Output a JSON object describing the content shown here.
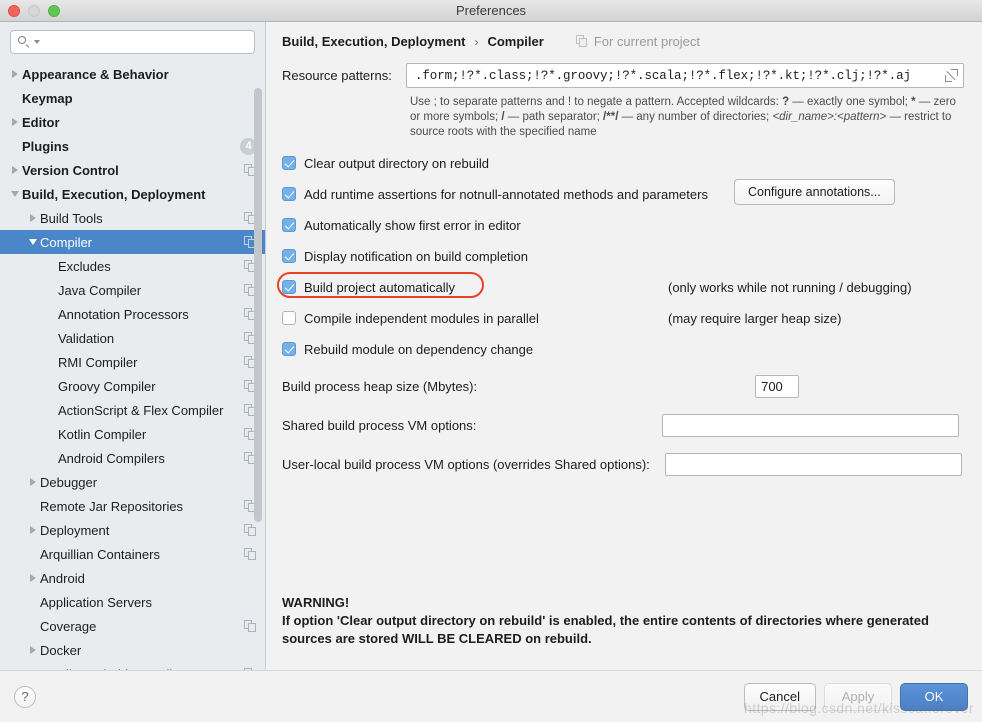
{
  "window": {
    "title": "Preferences",
    "traffic_lights": [
      "close",
      "minimize",
      "zoom"
    ]
  },
  "sidebar": {
    "search": {
      "value": "",
      "placeholder": ""
    },
    "items": [
      {
        "label": "Appearance & Behavior",
        "level": 0,
        "expandable": true,
        "expanded": false,
        "selected": false,
        "copy_icon": false,
        "badge": ""
      },
      {
        "label": "Keymap",
        "level": 0,
        "expandable": false,
        "expanded": false,
        "selected": false,
        "copy_icon": false,
        "badge": ""
      },
      {
        "label": "Editor",
        "level": 0,
        "expandable": true,
        "expanded": false,
        "selected": false,
        "copy_icon": false,
        "badge": ""
      },
      {
        "label": "Plugins",
        "level": 0,
        "expandable": false,
        "expanded": false,
        "selected": false,
        "copy_icon": false,
        "badge": "4"
      },
      {
        "label": "Version Control",
        "level": 0,
        "expandable": true,
        "expanded": false,
        "selected": false,
        "copy_icon": true,
        "badge": ""
      },
      {
        "label": "Build, Execution, Deployment",
        "level": 0,
        "expandable": true,
        "expanded": true,
        "selected": false,
        "copy_icon": false,
        "badge": ""
      },
      {
        "label": "Build Tools",
        "level": 1,
        "expandable": true,
        "expanded": false,
        "selected": false,
        "copy_icon": true,
        "badge": ""
      },
      {
        "label": "Compiler",
        "level": 1,
        "expandable": true,
        "expanded": true,
        "selected": true,
        "copy_icon": true,
        "badge": ""
      },
      {
        "label": "Excludes",
        "level": 2,
        "expandable": false,
        "expanded": false,
        "selected": false,
        "copy_icon": true,
        "badge": ""
      },
      {
        "label": "Java Compiler",
        "level": 2,
        "expandable": false,
        "expanded": false,
        "selected": false,
        "copy_icon": true,
        "badge": ""
      },
      {
        "label": "Annotation Processors",
        "level": 2,
        "expandable": false,
        "expanded": false,
        "selected": false,
        "copy_icon": true,
        "badge": ""
      },
      {
        "label": "Validation",
        "level": 2,
        "expandable": false,
        "expanded": false,
        "selected": false,
        "copy_icon": true,
        "badge": ""
      },
      {
        "label": "RMI Compiler",
        "level": 2,
        "expandable": false,
        "expanded": false,
        "selected": false,
        "copy_icon": true,
        "badge": ""
      },
      {
        "label": "Groovy Compiler",
        "level": 2,
        "expandable": false,
        "expanded": false,
        "selected": false,
        "copy_icon": true,
        "badge": ""
      },
      {
        "label": "ActionScript & Flex Compiler",
        "level": 2,
        "expandable": false,
        "expanded": false,
        "selected": false,
        "copy_icon": true,
        "badge": ""
      },
      {
        "label": "Kotlin Compiler",
        "level": 2,
        "expandable": false,
        "expanded": false,
        "selected": false,
        "copy_icon": true,
        "badge": ""
      },
      {
        "label": "Android Compilers",
        "level": 2,
        "expandable": false,
        "expanded": false,
        "selected": false,
        "copy_icon": true,
        "badge": ""
      },
      {
        "label": "Debugger",
        "level": 1,
        "expandable": true,
        "expanded": false,
        "selected": false,
        "copy_icon": false,
        "badge": ""
      },
      {
        "label": "Remote Jar Repositories",
        "level": 1,
        "expandable": false,
        "expanded": false,
        "selected": false,
        "copy_icon": true,
        "badge": ""
      },
      {
        "label": "Deployment",
        "level": 1,
        "expandable": true,
        "expanded": false,
        "selected": false,
        "copy_icon": true,
        "badge": ""
      },
      {
        "label": "Arquillian Containers",
        "level": 1,
        "expandable": false,
        "expanded": false,
        "selected": false,
        "copy_icon": true,
        "badge": ""
      },
      {
        "label": "Android",
        "level": 1,
        "expandable": true,
        "expanded": false,
        "selected": false,
        "copy_icon": false,
        "badge": ""
      },
      {
        "label": "Application Servers",
        "level": 1,
        "expandable": false,
        "expanded": false,
        "selected": false,
        "copy_icon": false,
        "badge": ""
      },
      {
        "label": "Coverage",
        "level": 1,
        "expandable": false,
        "expanded": false,
        "selected": false,
        "copy_icon": true,
        "badge": ""
      },
      {
        "label": "Docker",
        "level": 1,
        "expandable": true,
        "expanded": false,
        "selected": false,
        "copy_icon": false,
        "badge": ""
      },
      {
        "label": "Gradle-Android Compiler",
        "level": 1,
        "expandable": false,
        "expanded": false,
        "selected": false,
        "copy_icon": true,
        "badge": ""
      }
    ]
  },
  "breadcrumb": {
    "parent": "Build, Execution, Deployment",
    "separator": "›",
    "current": "Compiler",
    "scope": "For current project"
  },
  "resource_patterns": {
    "label": "Resource patterns:",
    "value": ".form;!?*.class;!?*.groovy;!?*.scala;!?*.flex;!?*.kt;!?*.clj;!?*.aj",
    "placeholder": "",
    "hint_line1_a": "Use ; to separate patterns and ! to negate a pattern. Accepted wildcards: ",
    "hint_bold1": "?",
    "hint_line1_b": " — exactly one symbol; ",
    "hint_bold2": "*",
    "hint_line1_c": " — zero or more symbols; ",
    "hint_bold3": "/",
    "hint_line1_d": " — path separator; ",
    "hint_bold4": "/**/",
    "hint_line1_e": " — any number of directories; ",
    "hint_italic": "<dir_name>:<pattern>",
    "hint_line1_f": " — restrict to source roots with the specified name"
  },
  "checkboxes": [
    {
      "label": "Clear output directory on rebuild",
      "checked": true,
      "note": "",
      "annotated": false
    },
    {
      "label": "Add runtime assertions for notnull-annotated methods and parameters",
      "checked": true,
      "note": "",
      "annotated": false,
      "button": "Configure annotations..."
    },
    {
      "label": "Automatically show first error in editor",
      "checked": true,
      "note": "",
      "annotated": false
    },
    {
      "label": "Display notification on build completion",
      "checked": true,
      "note": "",
      "annotated": false
    },
    {
      "label": "Build project automatically",
      "checked": true,
      "note": "(only works while not running / debugging)",
      "annotated": true
    },
    {
      "label": "Compile independent modules in parallel",
      "checked": false,
      "note": "(may require larger heap size)",
      "annotated": false
    },
    {
      "label": "Rebuild module on dependency change",
      "checked": true,
      "note": "",
      "annotated": false
    }
  ],
  "fields": {
    "heap": {
      "label": "Build process heap size (Mbytes):",
      "value": "700",
      "placeholder": ""
    },
    "shared_vm": {
      "label": "Shared build process VM options:",
      "value": "",
      "placeholder": ""
    },
    "user_vm": {
      "label": "User-local build process VM options (overrides Shared options):",
      "value": "",
      "placeholder": ""
    }
  },
  "warning": {
    "title": "WARNING!",
    "line1": "If option 'Clear output directory on rebuild' is enabled, the entire contents of directories where generated",
    "line2": "sources are stored WILL BE CLEARED on rebuild."
  },
  "footer": {
    "help": "?",
    "cancel": "Cancel",
    "apply": "Apply",
    "ok": "OK"
  },
  "watermark": "https://blog.csdn.net/kisscatforever",
  "colors": {
    "selection": "#4a86c8",
    "primary_button": "#4a80c8",
    "annotation": "#e8422a",
    "checkbox_on": "#76b0e8"
  }
}
